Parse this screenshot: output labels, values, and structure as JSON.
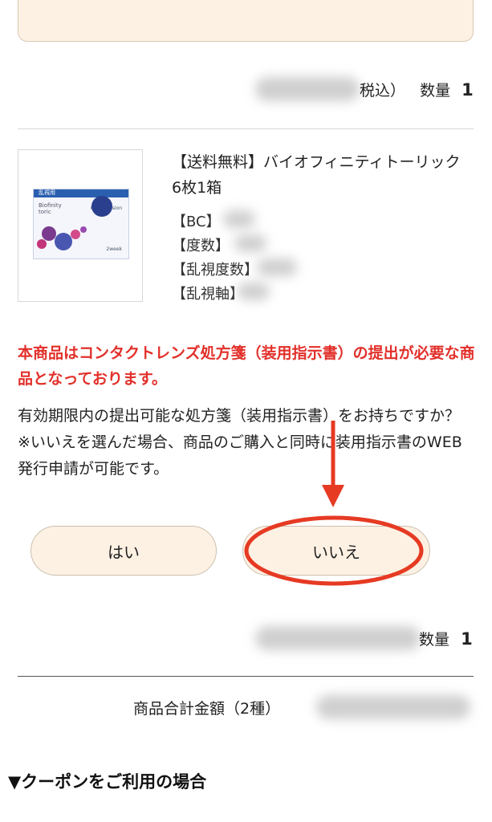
{
  "order_item_1": {
    "price_tail": "税込）",
    "qty_label": "数量",
    "qty_value": "1"
  },
  "product": {
    "name": "【送料無料】バイオフィニティトーリック6枚1箱",
    "image_alt": "Biofinity toric",
    "box_band_text": "乱視用",
    "box_brand_line1": "Biofinity",
    "box_brand_line2": "toric",
    "box_logo": "CooperVision",
    "box_sub": "2week",
    "specs": [
      {
        "label": "【BC】"
      },
      {
        "label": "【度数】"
      },
      {
        "label": "【乱視度数】"
      },
      {
        "label": "【乱視軸】"
      }
    ]
  },
  "notice": {
    "warning": "本商品はコンタクトレンズ処方箋（装用指示書）の提出が必要な商品となっております。",
    "question": "有効期限内の提出可能な処方箋（装用指示書）をお持ちですか？",
    "note": "※いいえを選んだ場合、商品のご購入と同時に装用指示書のWEB発行申請が可能です。"
  },
  "buttons": {
    "yes": "はい",
    "no": "いいえ"
  },
  "order_item_2": {
    "qty_label": "数量",
    "qty_value": "1"
  },
  "summary": {
    "total_label": "商品合計金額（2種）"
  },
  "coupon": {
    "heading": "▼クーポンをご利用の場合"
  },
  "colors": {
    "warning_red": "#e2302a",
    "button_bg": "#fdf1e3",
    "annotation_red": "#e63a23"
  }
}
